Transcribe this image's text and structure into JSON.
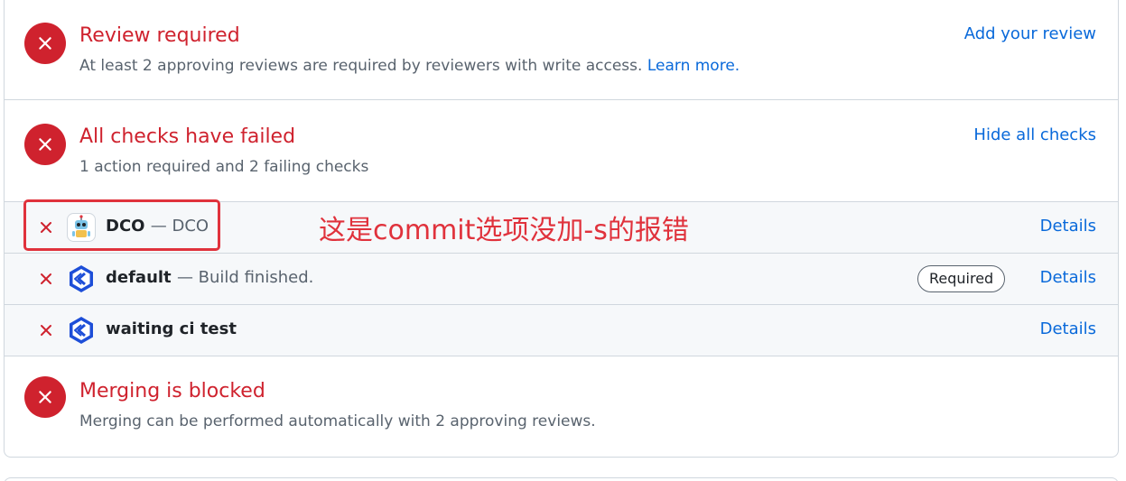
{
  "review": {
    "title": "Review required",
    "description": "At least 2 approving reviews are required by reviewers with write access.",
    "learn_more": "Learn more.",
    "action": "Add your review"
  },
  "checks": {
    "title": "All checks have failed",
    "description": "1 action required and 2 failing checks",
    "action": "Hide all checks",
    "items": [
      {
        "name": "DCO",
        "desc": "— DCO",
        "details": "Details",
        "icon": "dco-bot-icon"
      },
      {
        "name": "default",
        "desc": "— Build finished.",
        "badge": "Required",
        "details": "Details",
        "icon": "ci-logo-icon"
      },
      {
        "name": "waiting ci test",
        "desc": "",
        "details": "Details",
        "icon": "ci-logo-icon"
      }
    ]
  },
  "merge": {
    "title": "Merging is blocked",
    "description": "Merging can be performed automatically with 2 approving reviews."
  },
  "annotation": {
    "text": "这是commit选项没加-s的报错"
  },
  "colors": {
    "danger": "#cf222e",
    "link": "#0969da",
    "muted": "#59636e",
    "annotation": "#e0323c"
  }
}
